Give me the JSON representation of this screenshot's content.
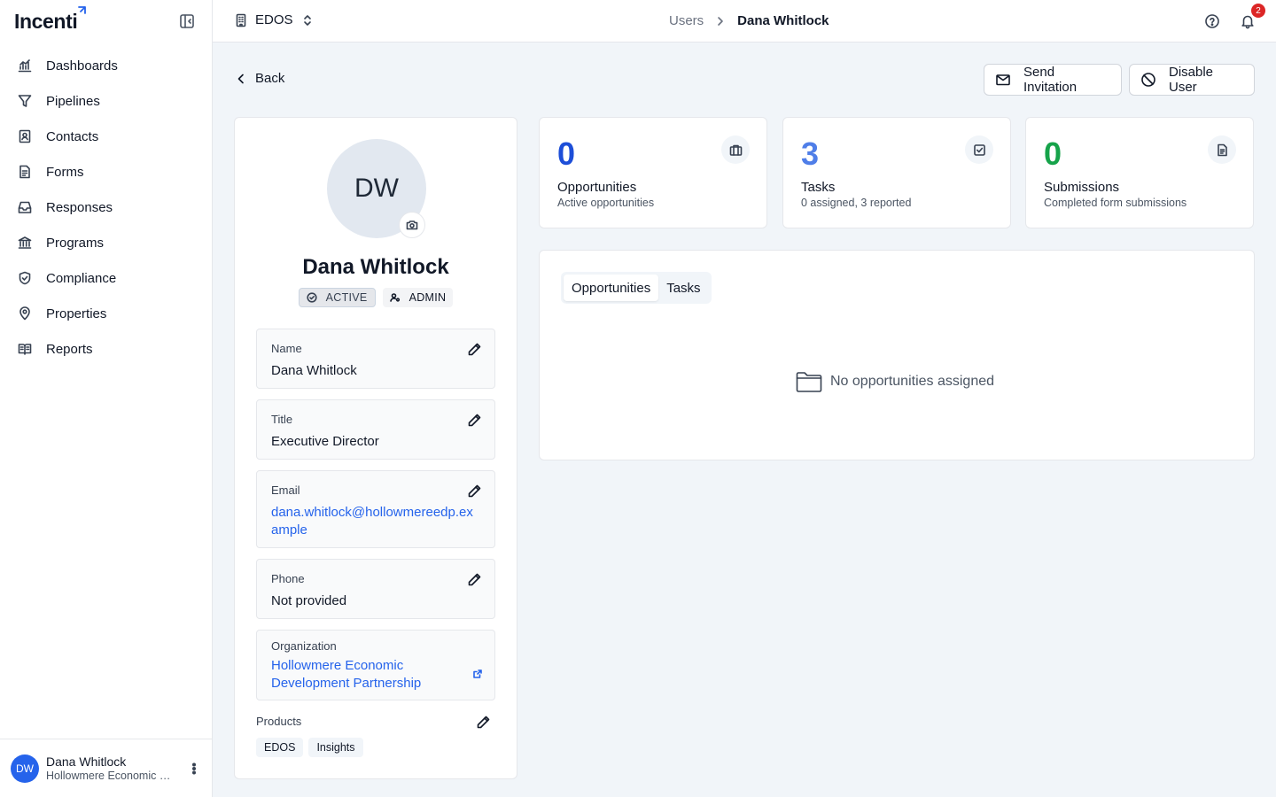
{
  "app": {
    "logo_text": "Incenti"
  },
  "sidebar": {
    "items": [
      {
        "label": "Dashboards",
        "icon": "chart-icon"
      },
      {
        "label": "Pipelines",
        "icon": "filter-icon"
      },
      {
        "label": "Contacts",
        "icon": "contact-book-icon"
      },
      {
        "label": "Forms",
        "icon": "form-icon"
      },
      {
        "label": "Responses",
        "icon": "inbox-icon"
      },
      {
        "label": "Programs",
        "icon": "bank-icon"
      },
      {
        "label": "Compliance",
        "icon": "shield-icon"
      },
      {
        "label": "Properties",
        "icon": "map-pin-icon"
      },
      {
        "label": "Reports",
        "icon": "book-icon"
      }
    ],
    "footer": {
      "initials": "DW",
      "name": "Dana Whitlock",
      "org": "Hollowmere Economic Development Partnership"
    }
  },
  "topbar": {
    "workspace": "EDOS",
    "breadcrumb": {
      "parent": "Users",
      "current": "Dana Whitlock"
    },
    "notification_count": "2"
  },
  "actions": {
    "back": "Back",
    "send_invitation": "Send Invitation",
    "disable_user": "Disable User"
  },
  "profile": {
    "initials": "DW",
    "name": "Dana Whitlock",
    "status_badge": "ACTIVE",
    "role_badge": "ADMIN",
    "fields": {
      "name": {
        "label": "Name",
        "value": "Dana Whitlock"
      },
      "title": {
        "label": "Title",
        "value": "Executive Director"
      },
      "email": {
        "label": "Email",
        "value": "dana.whitlock@hollowmereedp.example"
      },
      "phone": {
        "label": "Phone",
        "value": "Not provided"
      },
      "organization": {
        "label": "Organization",
        "value": "Hollowmere Economic Development Partnership"
      }
    },
    "products_label": "Products",
    "products": [
      "EDOS",
      "Insights"
    ]
  },
  "stats": [
    {
      "value": "0",
      "label": "Opportunities",
      "sub": "Active opportunities",
      "color": "#1d4ed8",
      "icon": "briefcase-icon"
    },
    {
      "value": "3",
      "label": "Tasks",
      "sub": "0 assigned, 3 reported",
      "color": "#4f7ee8",
      "icon": "checkbox-icon"
    },
    {
      "value": "0",
      "label": "Submissions",
      "sub": "Completed form submissions",
      "color": "#16a34a",
      "icon": "document-icon"
    }
  ],
  "tabs": {
    "items": [
      "Opportunities",
      "Tasks"
    ],
    "active": "Opportunities"
  },
  "empty_state": {
    "message": "No opportunities assigned",
    "icon": "folder-icon"
  },
  "colors": {
    "accent": "#2563eb",
    "badge_red": "#dc2626"
  }
}
